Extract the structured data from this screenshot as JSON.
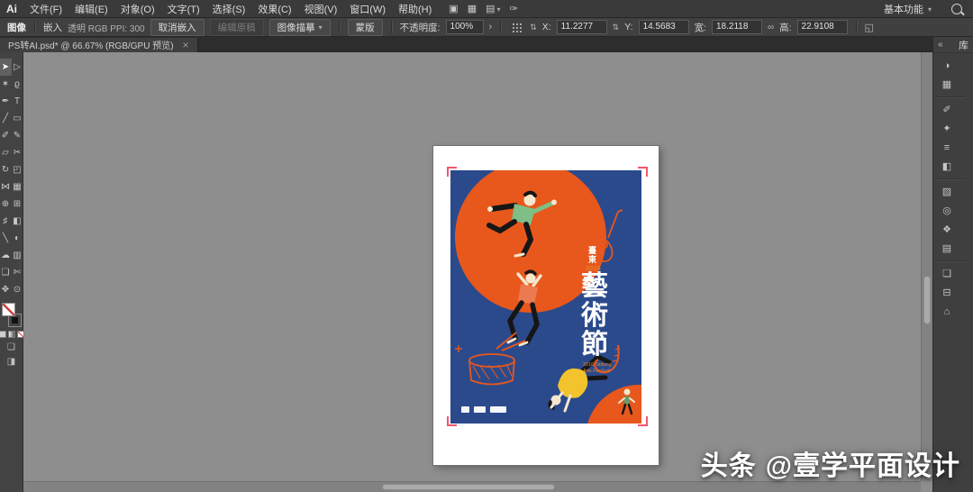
{
  "app": {
    "logo": "Ai",
    "menu": [
      "文件(F)",
      "编辑(E)",
      "对象(O)",
      "文字(T)",
      "选择(S)",
      "效果(C)",
      "视图(V)",
      "窗口(W)",
      "帮助(H)"
    ],
    "appbar_icons": [
      {
        "name": "gpu-performance-icon",
        "glyph": "▣"
      },
      {
        "name": "arrange-documents-icon",
        "glyph": "▦"
      },
      {
        "name": "document-layout-icon",
        "glyph": "▤"
      },
      {
        "name": "share-document-icon",
        "glyph": "✑"
      }
    ],
    "workspace": "基本功能"
  },
  "controlbar": {
    "context_label": "图像",
    "embed_label": "嵌入",
    "file_info": "透明 RGB PPI: 300",
    "unembed_button": "取消嵌入",
    "edit_original_button": "编辑原稿",
    "image_trace_button": "图像描摹",
    "mask_button": "蒙版",
    "opacity_label": "不透明度:",
    "opacity_value": "100%",
    "x_label": "X:",
    "x_value": "11.2277",
    "y_label": "Y:",
    "y_value": "14.5683",
    "w_label": "宽:",
    "w_value": "18.2118",
    "h_label": "高:",
    "h_value": "22.9108"
  },
  "tabbar": {
    "document_title": "PS转AI.psd* @ 66.67% (RGB/GPU 预览)",
    "close_glyph": "×"
  },
  "tools": [
    {
      "name": "selection-tool",
      "glyph": "➤"
    },
    {
      "name": "direct-selection-tool",
      "glyph": "▷"
    },
    {
      "name": "magic-wand-tool",
      "glyph": "✶"
    },
    {
      "name": "lasso-tool",
      "glyph": "ϱ"
    },
    {
      "name": "pen-tool",
      "glyph": "✒"
    },
    {
      "name": "type-tool",
      "glyph": "T"
    },
    {
      "name": "line-segment-tool",
      "glyph": "╱"
    },
    {
      "name": "rectangle-tool",
      "glyph": "▭"
    },
    {
      "name": "paintbrush-tool",
      "glyph": "✐"
    },
    {
      "name": "pencil-tool",
      "glyph": "✎"
    },
    {
      "name": "eraser-tool",
      "glyph": "▱"
    },
    {
      "name": "scissors-tool",
      "glyph": "✂"
    },
    {
      "name": "rotate-tool",
      "glyph": "↻"
    },
    {
      "name": "scale-tool",
      "glyph": "◰"
    },
    {
      "name": "width-tool",
      "glyph": "⋈"
    },
    {
      "name": "free-transform-tool",
      "glyph": "▦"
    },
    {
      "name": "shape-builder-tool",
      "glyph": "⊕"
    },
    {
      "name": "perspective-grid-tool",
      "glyph": "⊞"
    },
    {
      "name": "mesh-tool",
      "glyph": "♯"
    },
    {
      "name": "gradient-tool",
      "glyph": "◧"
    },
    {
      "name": "eyedropper-tool",
      "glyph": "╲"
    },
    {
      "name": "blend-tool",
      "glyph": "◐"
    },
    {
      "name": "symbol-sprayer-tool",
      "glyph": "☁"
    },
    {
      "name": "column-graph-tool",
      "glyph": "▥"
    },
    {
      "name": "artboard-tool",
      "glyph": "❏"
    },
    {
      "name": "slice-tool",
      "glyph": "✄"
    },
    {
      "name": "hand-tool",
      "glyph": "✥"
    },
    {
      "name": "zoom-tool",
      "glyph": "⊙"
    }
  ],
  "dock": {
    "collapse_glyph": "«",
    "library_label": "库",
    "icons": [
      {
        "name": "color-panel-icon",
        "glyph": "◑"
      },
      {
        "name": "swatches-panel-icon",
        "glyph": "▦"
      },
      {
        "name": "brushes-panel-icon",
        "glyph": "✐"
      },
      {
        "name": "symbols-panel-icon",
        "glyph": "✦"
      },
      {
        "name": "stroke-panel-icon",
        "glyph": "≡"
      },
      {
        "name": "gradient-panel-icon",
        "glyph": "◧"
      },
      {
        "name": "transparency-panel-icon",
        "glyph": "▨"
      },
      {
        "name": "appearance-panel-icon",
        "glyph": "◎"
      },
      {
        "name": "graphic-styles-panel-icon",
        "glyph": "❖"
      },
      {
        "name": "layers-panel-icon",
        "glyph": "▤"
      },
      {
        "name": "artboards-panel-icon",
        "glyph": "❏"
      },
      {
        "name": "align-panel-icon",
        "glyph": "⊟"
      },
      {
        "name": "libraries-panel-icon",
        "glyph": "⌂"
      }
    ]
  },
  "poster": {
    "location": "臺東",
    "year": "2016",
    "title": [
      "藝",
      "術",
      "節"
    ],
    "en_line1": "2016 Taitung",
    "en_line2": "Arts Festival",
    "colors": {
      "background": "#2B4A8C",
      "orange": "#E8571C",
      "yellow": "#F2C32D",
      "green": "#7FBE84",
      "corner_marks": "#F2566E"
    }
  },
  "watermark": {
    "brand": "头条",
    "handle": "@壹学平面设计"
  }
}
